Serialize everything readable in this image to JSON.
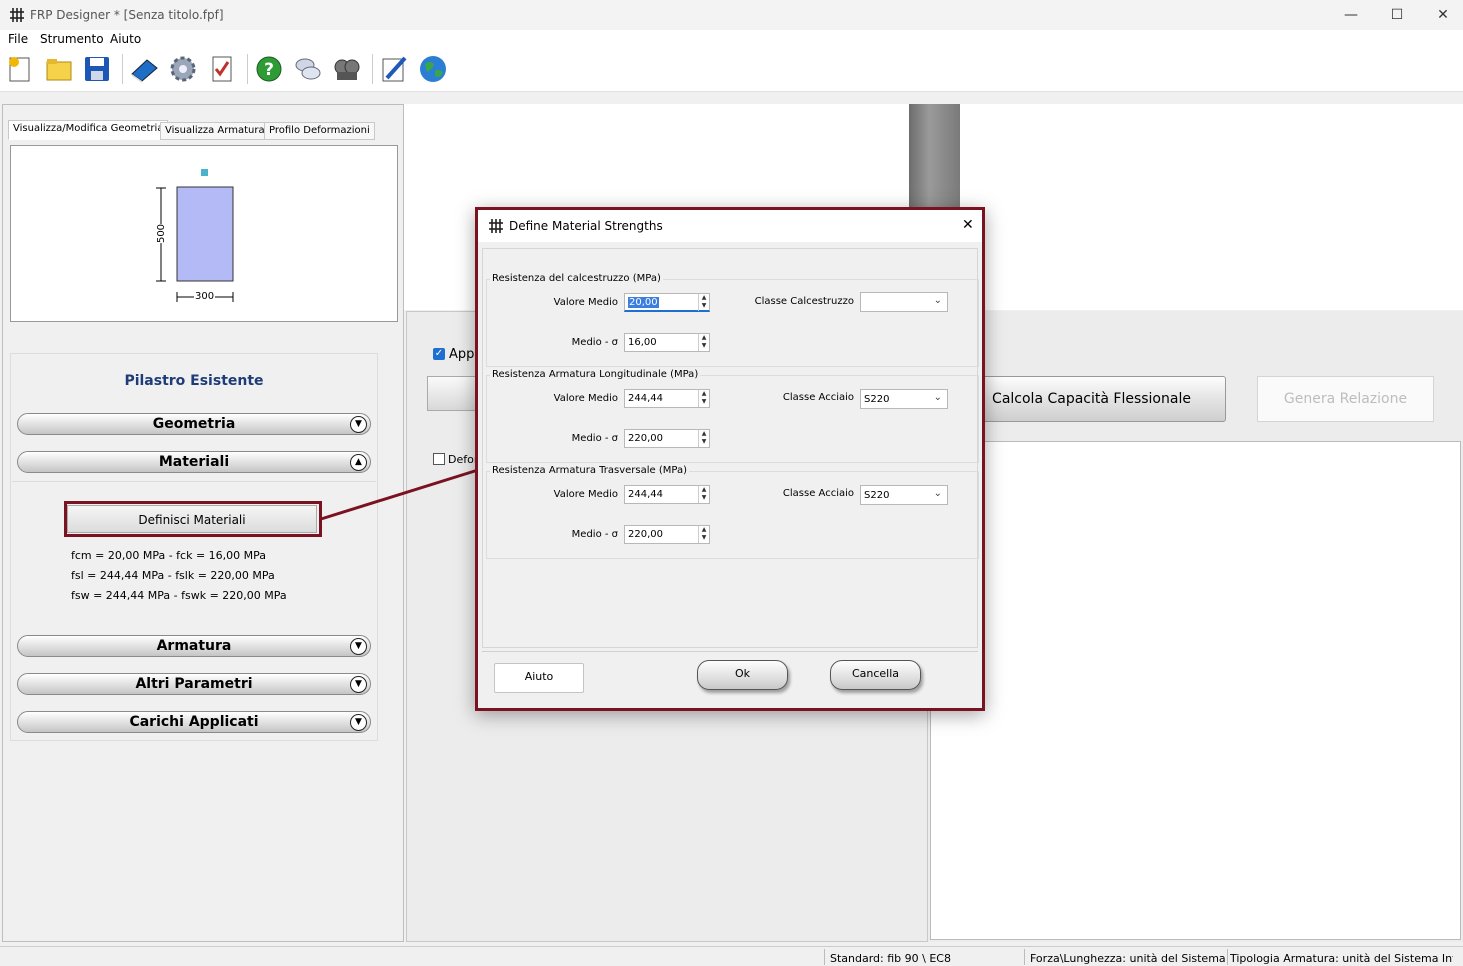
{
  "window": {
    "title": "FRP Designer * [Senza titolo.fpf]",
    "min": "—",
    "max": "☐",
    "close": "✕"
  },
  "menu": [
    "File",
    "Strumento",
    "Aiuto"
  ],
  "tabs": [
    "Visualizza/Modifica Geometria",
    "Visualizza Armatura",
    "Profilo Deformazioni"
  ],
  "geometry": {
    "height": "500",
    "width": "300"
  },
  "panel": {
    "title": "Pilastro Esistente",
    "sections": [
      "Geometria",
      "Materiali",
      "Armatura",
      "Altri Parametri",
      "Carichi Applicati"
    ],
    "define_button": "Definisci Materiali",
    "lines": [
      "fcm = 20,00 MPa   -   fck = 16,00 MPa",
      "fsl = 244,44 MPa   -   fslk = 220,00 MPa",
      "fsw = 244,44 MPa   -   fswk = 220,00 MPa"
    ]
  },
  "mid": {
    "checkbox1": "App",
    "checkbox2": "Defor"
  },
  "buttons": {
    "calc": "Calcola Capacità Flessionale",
    "report": "Genera Relazione"
  },
  "status": [
    "Standard: fib 90 \\ EC8",
    "Forza\\Lunghezza: unità del Sistema Ir",
    "Tipologia Armatura: unità del Sistema Inte"
  ],
  "dialog": {
    "title": "Define Material Strengths",
    "close": "✕",
    "groups": [
      {
        "label": "Resistenza del calcestruzzo (MPa)",
        "mean_label": "Valore Medio",
        "mean": "20,00",
        "sigma_label": "Medio - σ",
        "sigma": "16,00",
        "class_label": "Classe Calcestruzzo",
        "class": ""
      },
      {
        "label": "Resistenza Armatura Longitudinale (MPa)",
        "mean_label": "Valore Medio",
        "mean": "244,44",
        "sigma_label": "Medio - σ",
        "sigma": "220,00",
        "class_label": "Classe Acciaio",
        "class": "S220"
      },
      {
        "label": "Resistenza Armatura Trasversale (MPa)",
        "mean_label": "Valore Medio",
        "mean": "244,44",
        "sigma_label": "Medio - σ",
        "sigma": "220,00",
        "class_label": "Classe Acciaio",
        "class": "S220"
      }
    ],
    "help": "Aiuto",
    "ok": "Ok",
    "cancel": "Cancella"
  }
}
